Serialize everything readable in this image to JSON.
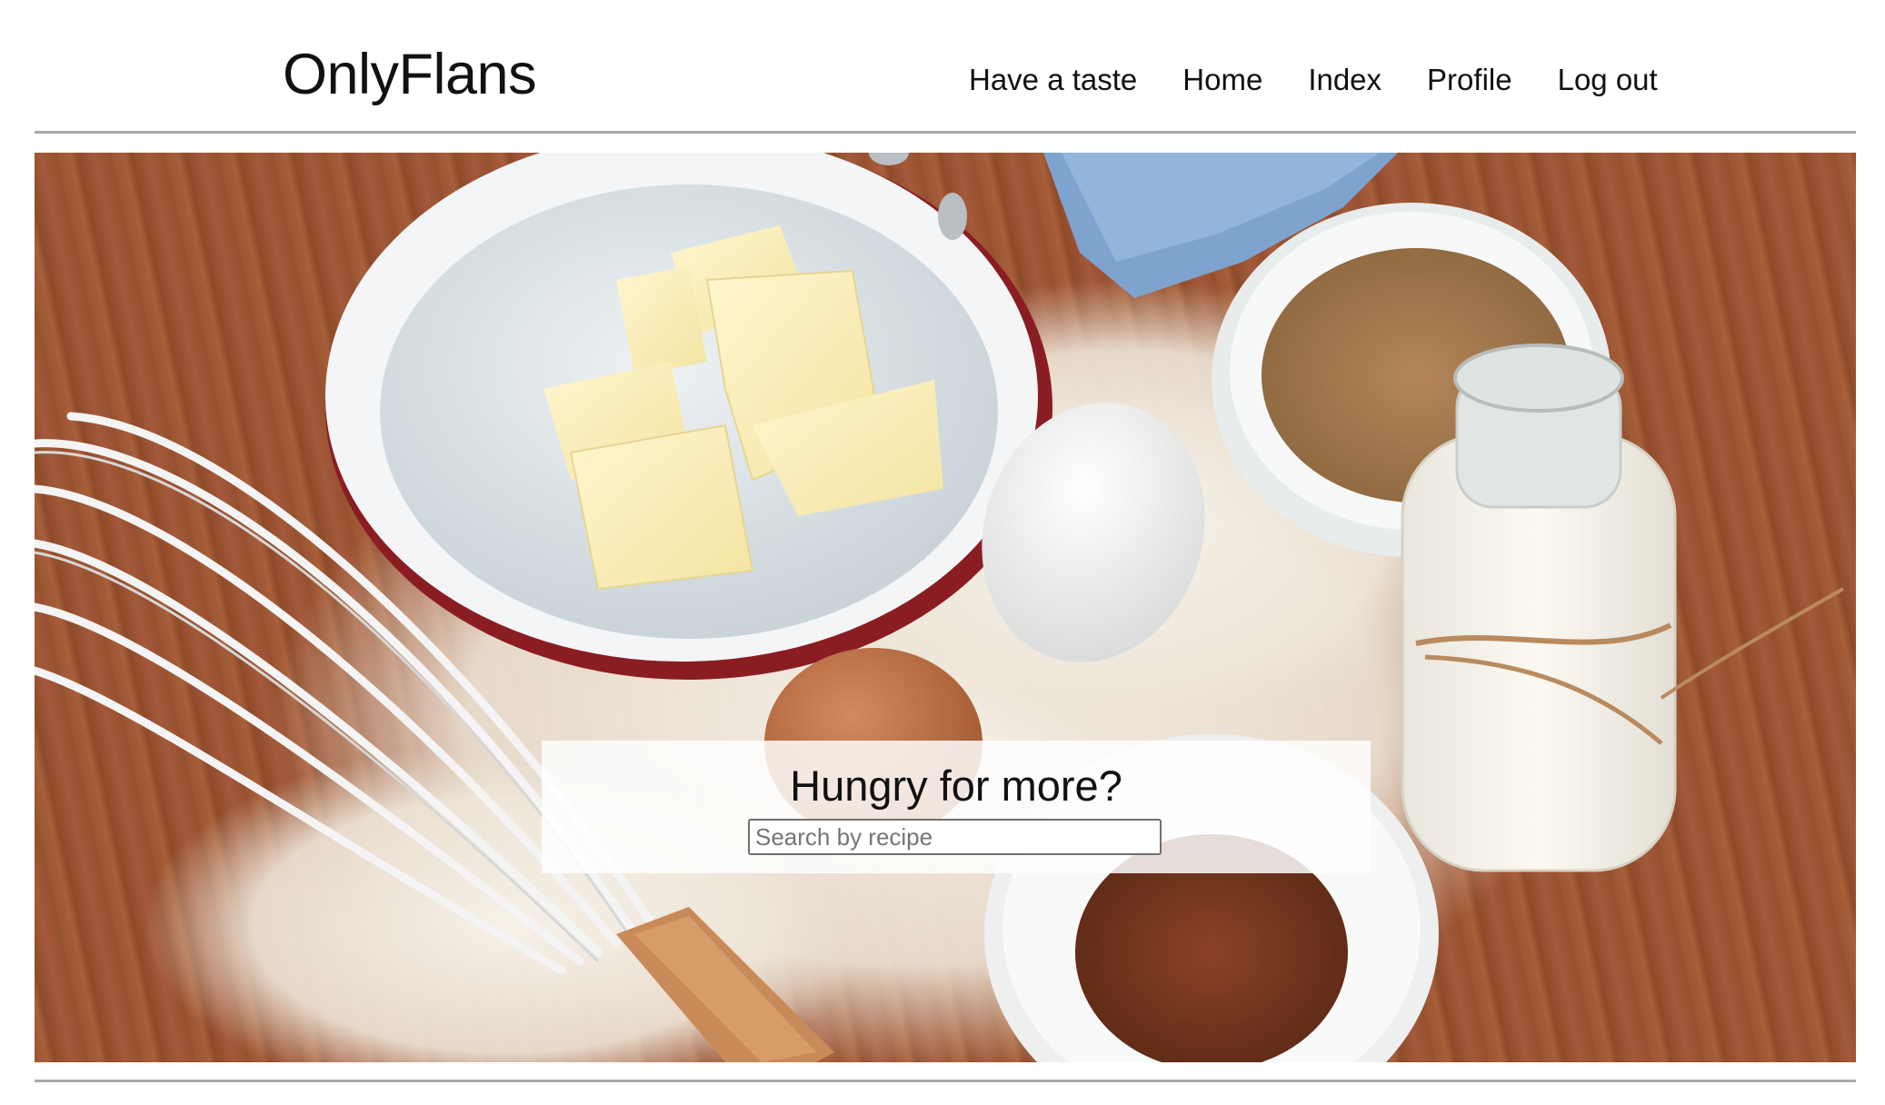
{
  "header": {
    "brand": "OnlyFlans",
    "nav": [
      {
        "label": "Have a taste"
      },
      {
        "label": "Home"
      },
      {
        "label": "Index"
      },
      {
        "label": "Profile"
      },
      {
        "label": "Log out"
      }
    ]
  },
  "hero": {
    "image": "baking-ingredients-photo",
    "search": {
      "title": "Hungry for more?",
      "value": "",
      "placeholder": "Search by recipe"
    }
  },
  "colors": {
    "text": "#111111",
    "divider": "#a9a9a9",
    "search_border": "#6f6f6f"
  }
}
